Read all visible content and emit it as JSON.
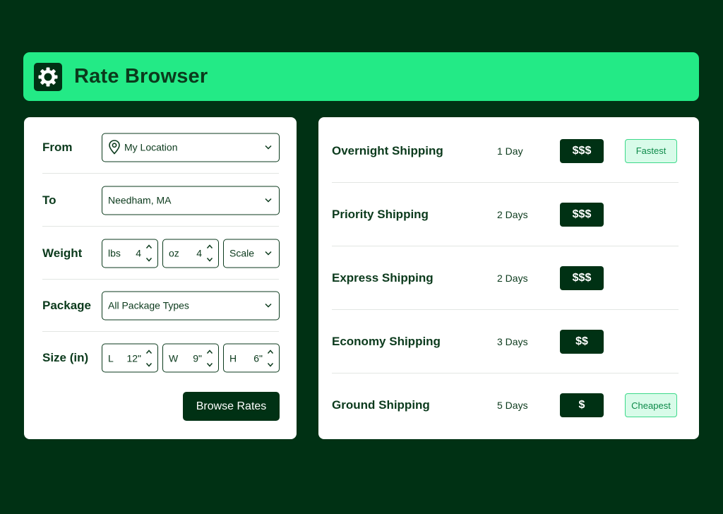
{
  "app": {
    "title": "Rate Browser",
    "logo_icon": "gear-icon"
  },
  "colors": {
    "background": "#003114",
    "accent": "#23ea86",
    "text": "#0b3a1c",
    "tag_bg": "#d8fbe9"
  },
  "form": {
    "from": {
      "label": "From",
      "value": "My Location"
    },
    "to": {
      "label": "To",
      "value": "Needham, MA"
    },
    "weight": {
      "label": "Weight",
      "lbs": {
        "unit": "lbs",
        "value": "4"
      },
      "oz": {
        "unit": "oz",
        "value": "4"
      },
      "scale": {
        "value": "Scale"
      }
    },
    "package": {
      "label": "Package",
      "value": "All Package Types"
    },
    "size": {
      "label": "Size (in)",
      "l": {
        "unit": "L",
        "value": "12\""
      },
      "w": {
        "unit": "W",
        "value": "9\""
      },
      "h": {
        "unit": "H",
        "value": "6\""
      }
    },
    "browse_label": "Browse Rates"
  },
  "rates": [
    {
      "name": "Overnight Shipping",
      "days": "1 Day",
      "price": "$$$",
      "tag": "Fastest"
    },
    {
      "name": "Priority Shipping",
      "days": "2 Days",
      "price": "$$$",
      "tag": ""
    },
    {
      "name": "Express Shipping",
      "days": "2 Days",
      "price": "$$$",
      "tag": ""
    },
    {
      "name": "Economy Shipping",
      "days": "3 Days",
      "price": "$$",
      "tag": ""
    },
    {
      "name": "Ground Shipping",
      "days": "5 Days",
      "price": "$",
      "tag": "Cheapest"
    }
  ]
}
